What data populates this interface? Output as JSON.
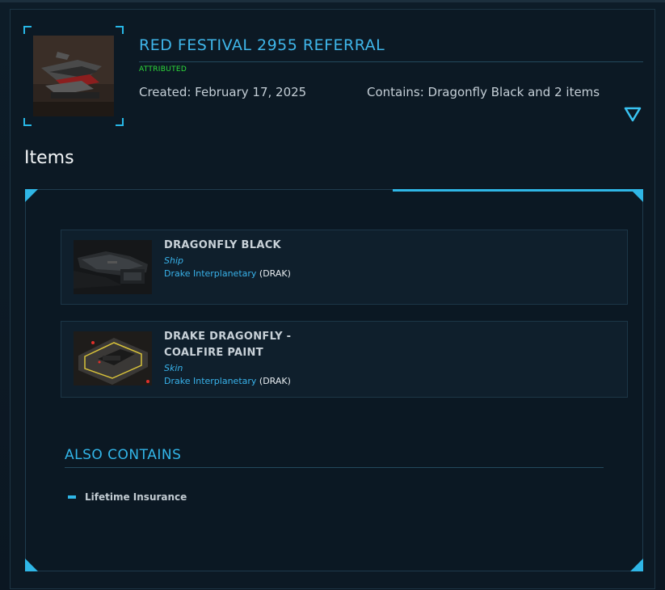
{
  "package": {
    "title": "RED FESTIVAL 2955 REFERRAL",
    "status": "ATTRIBUTED",
    "created": "Created: February 17, 2025",
    "contains": "Contains: Dragonfly Black and 2 items"
  },
  "items_heading": "Items",
  "items": [
    {
      "name": "DRAGONFLY BLACK",
      "type": "Ship",
      "manufacturer": "Drake Interplanetary",
      "code": "(DRAK)"
    },
    {
      "name": "DRAKE DRAGONFLY - COALFIRE PAINT",
      "type": "Skin",
      "manufacturer": "Drake Interplanetary",
      "code": "(DRAK)"
    }
  ],
  "also_contains": {
    "heading": "ALSO CONTAINS",
    "items": [
      "Lifetime Insurance"
    ]
  },
  "colors": {
    "accent": "#2fb6e6",
    "title": "#3fb6ea",
    "status": "#2edb3a",
    "background": "#0b1823"
  },
  "icons": {
    "expand": "chevron-down-triangle-icon"
  }
}
